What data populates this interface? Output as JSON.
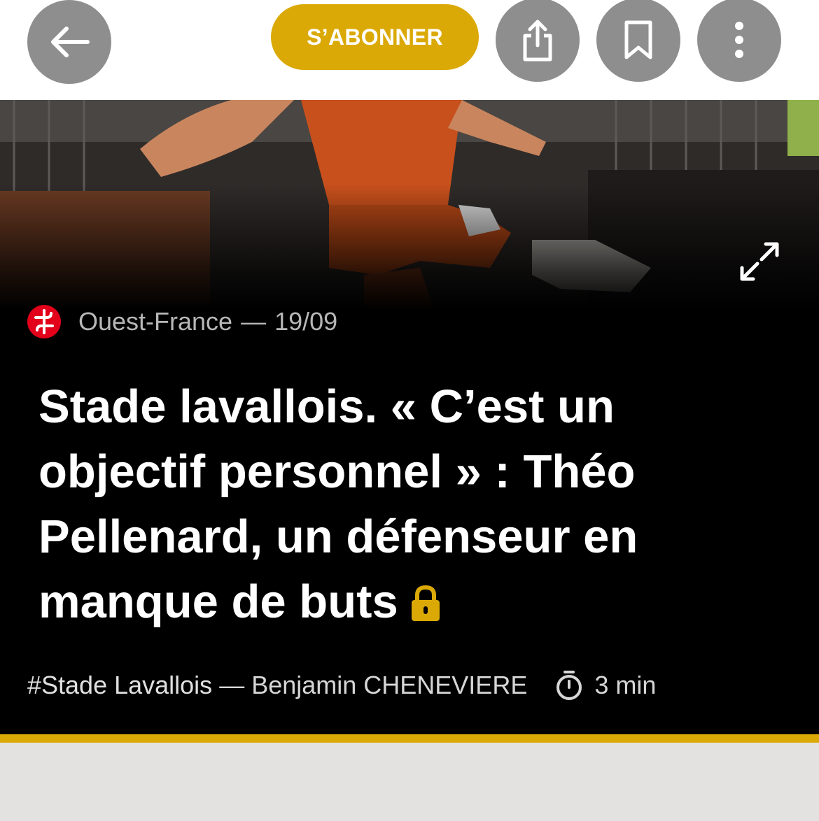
{
  "toolbar": {
    "subscribe_label": "S’ABONNER",
    "accent_color": "#dba906",
    "icons": [
      "back-arrow-icon",
      "share-icon",
      "bookmark-icon",
      "more-vertical-icon"
    ]
  },
  "article": {
    "source": "Ouest-France",
    "source_separator": "—",
    "date": "19/09",
    "title": "Stade lavallois. « C’est un objectif personnel » : Théo Pellenard, un défenseur en manque de buts",
    "tag": "#Stade Lavallois",
    "author_separator": "—",
    "author": "Benjamin CHENEVIERE",
    "reading_time": "3 min",
    "premium": true,
    "icons": [
      "expand-icon",
      "lock-icon",
      "timer-icon"
    ]
  }
}
